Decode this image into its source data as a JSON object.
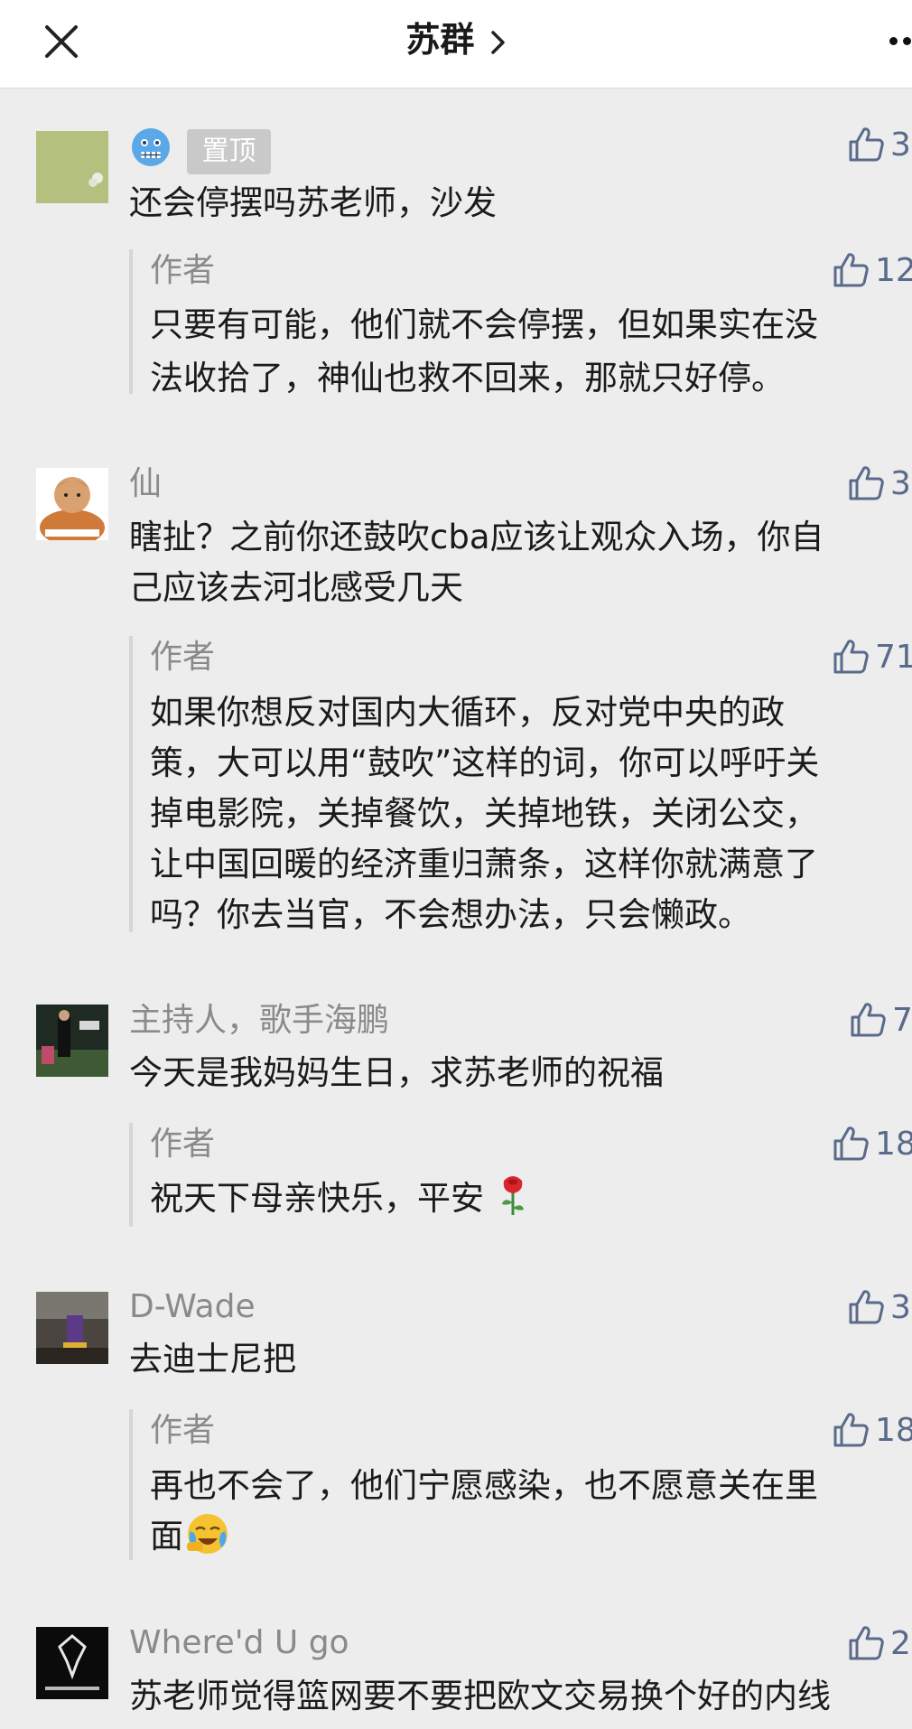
{
  "header": {
    "title": "苏群",
    "icons": {
      "close": "close-icon",
      "chevron": "chevron-right-icon",
      "more": "more-icon"
    }
  },
  "comments": [
    {
      "name": "",
      "pinned_label": "置顶",
      "name_emoji": "cold-face-emoji",
      "text_lines": [
        "还会停摆吗苏老师，沙发"
      ],
      "likes": "3",
      "reply": {
        "author_label": "作者",
        "likes": "12",
        "text_lines": [
          "只要有可能，他们就不会停摆，但如果实在没",
          "法收拾了，神仙也救不回来，那就只好停。"
        ]
      }
    },
    {
      "name": "仙",
      "text_lines": [
        "瞎扯？之前你还鼓吹cba应该让观众入场，你自",
        "己应该去河北感受几天"
      ],
      "likes": "3",
      "reply": {
        "author_label": "作者",
        "likes": "71",
        "text_lines": [
          "如果你想反对国内大循环，反对党中央的政",
          "策，大可以用“鼓吹”这样的词，你可以呼吁关",
          "掉电影院，关掉餐饮，关掉地铁，关闭公交，",
          "让中国回暖的经济重归萧条，这样你就满意了",
          "吗？你去当官，不会想办法，只会懒政。"
        ]
      }
    },
    {
      "name": "主持人，歌手海鹏",
      "text_lines": [
        "今天是我妈妈生日，求苏老师的祝福"
      ],
      "likes": "7",
      "reply": {
        "author_label": "作者",
        "likes": "18",
        "text_lines": [
          "祝天下母亲快乐，平安"
        ],
        "text_emoji": "rose-emoji"
      }
    },
    {
      "name": "D-Wade",
      "text_lines": [
        "去迪士尼把"
      ],
      "likes": "3",
      "reply": {
        "author_label": "作者",
        "likes": "18",
        "text_lines": [
          "再也不会了，他们宁愿感染，也不愿意关在里",
          "面"
        ],
        "text_emoji": "crying-face-emoji"
      }
    },
    {
      "name": "Where'd U go",
      "text_lines": [
        "苏老师觉得篮网要不要把欧文交易换个好的内线"
      ],
      "likes": "2"
    }
  ],
  "colors": {
    "page_bg": "#ededed",
    "header_bg": "#ffffff",
    "name_gray": "#8a8a8a",
    "like_blue": "#5a6a8a",
    "text": "#1b1b1b"
  }
}
